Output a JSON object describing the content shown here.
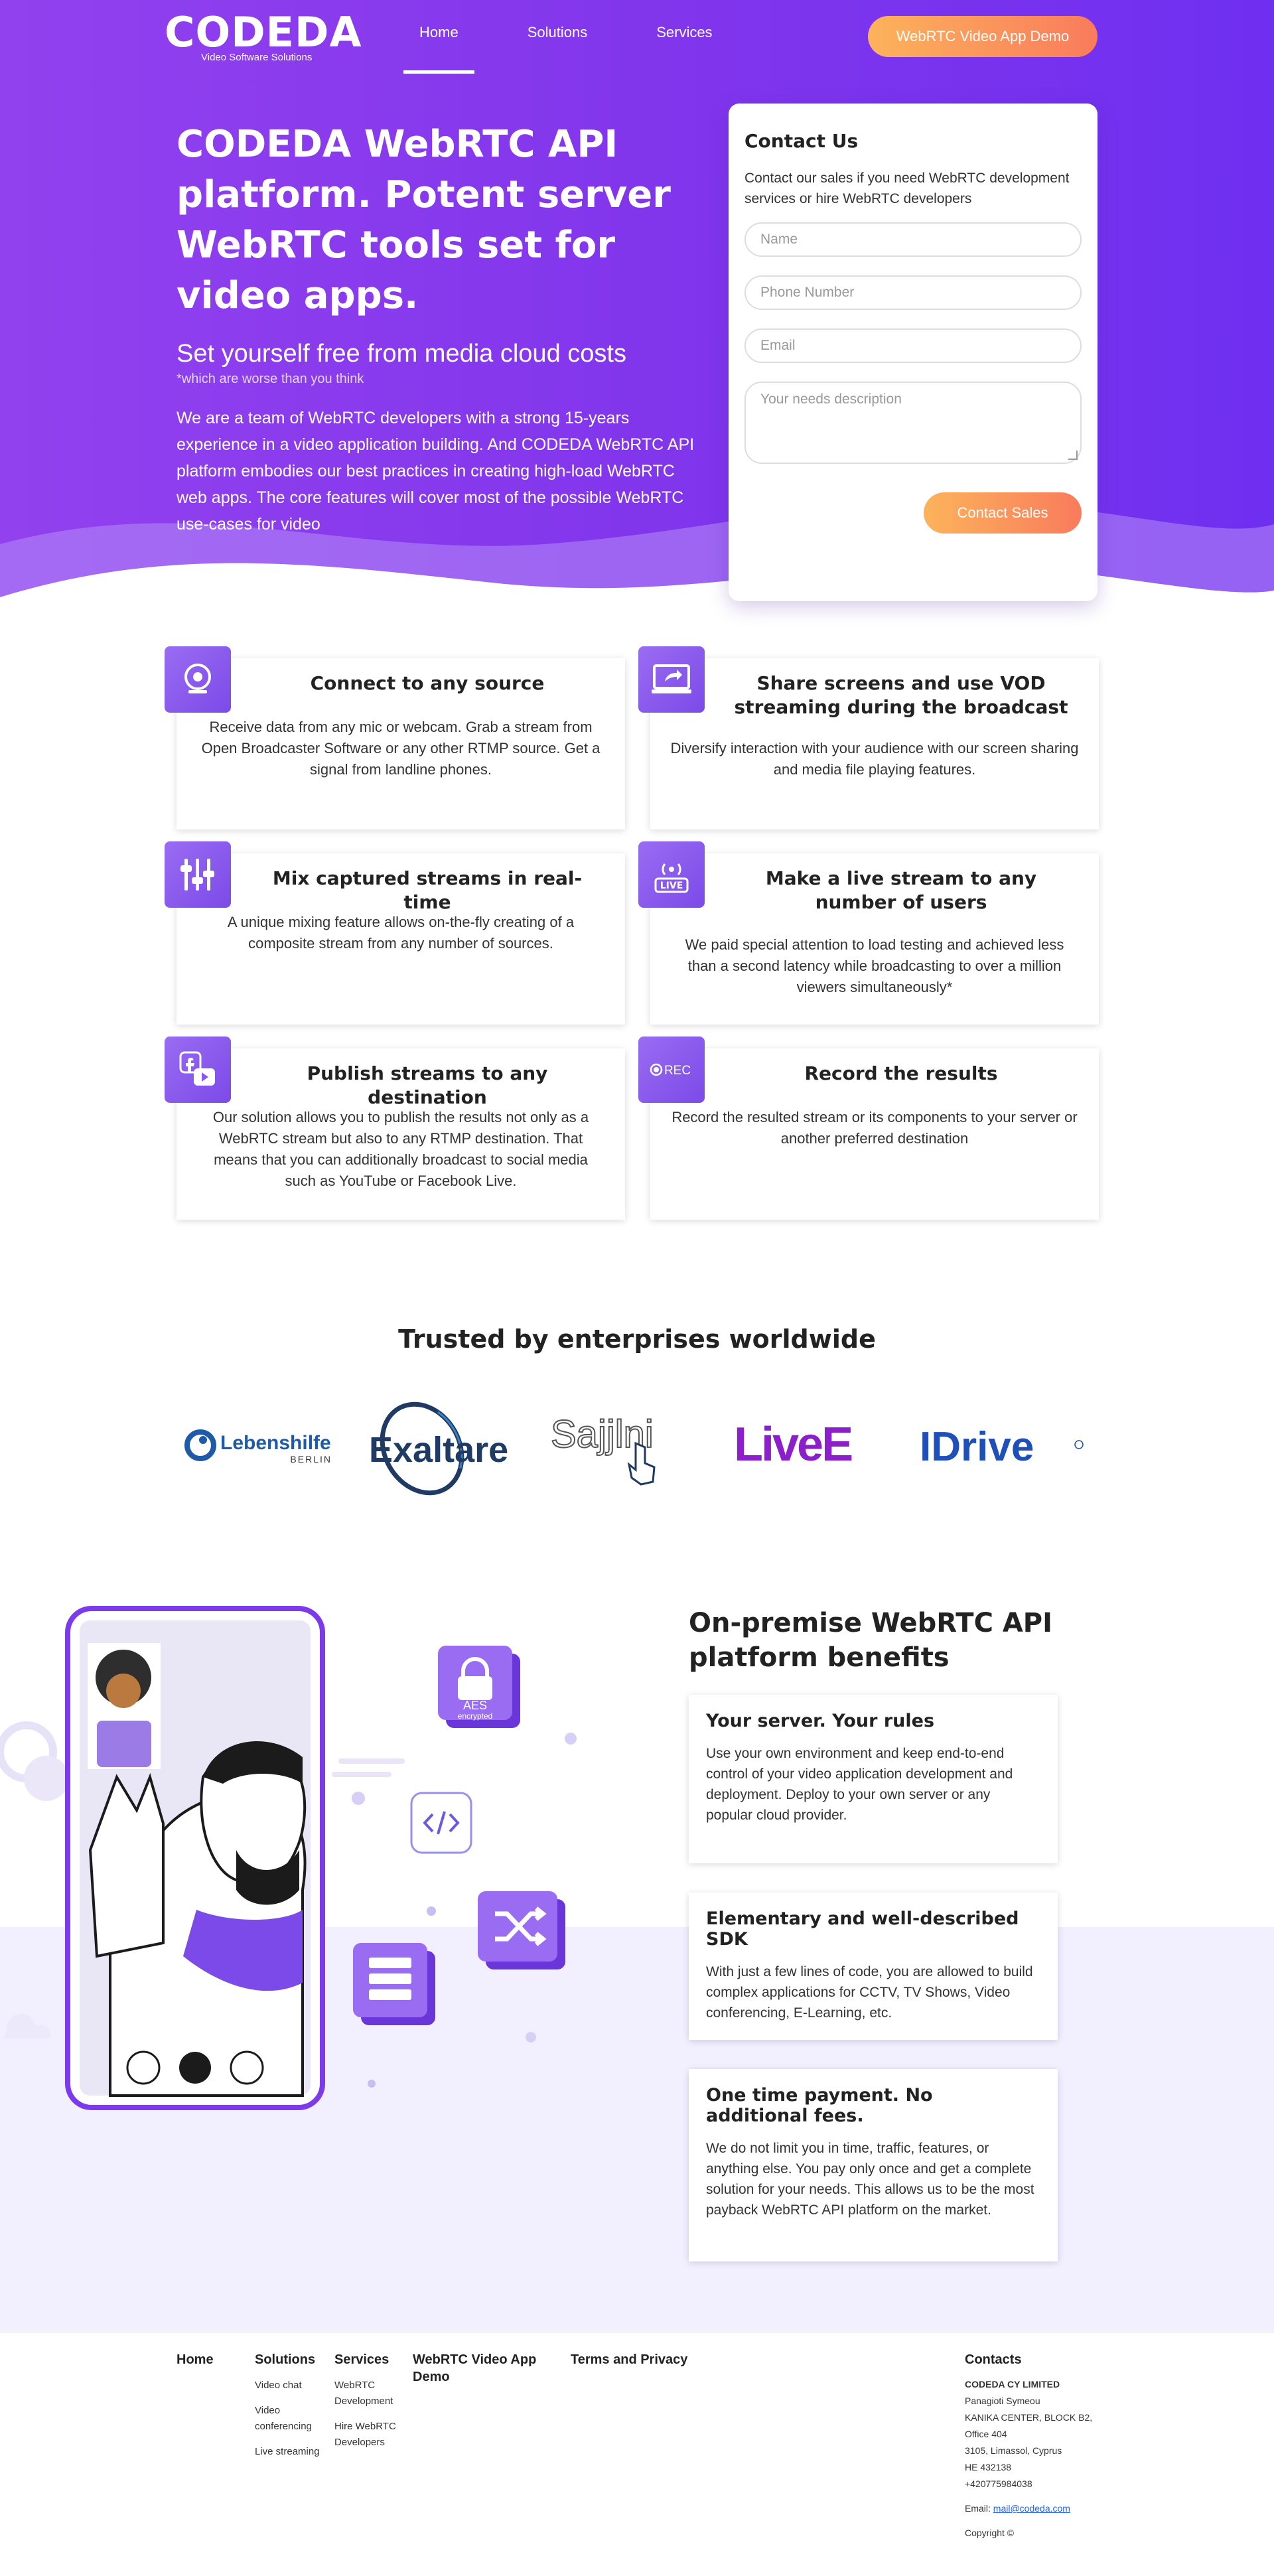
{
  "header": {
    "logo": "CODEDA",
    "logo_sub": "Video Software Solutions",
    "nav": [
      "Home",
      "Solutions",
      "Services"
    ],
    "demo_button": "WebRTC Video App Demo"
  },
  "hero": {
    "title": "CODEDA WebRTC API platform. Potent server WebRTC tools set for video apps.",
    "subtitle": "Set yourself free from media cloud costs",
    "note": "*which are worse than you think",
    "description": "We are a team of WebRTC developers with a strong 15-years experience in a video application building. And CODEDA WebRTC API platform embodies our best practices in creating high-load WebRTC web apps. The core features will cover most of the possible WebRTC use-cases for video"
  },
  "contact": {
    "title": "Contact Us",
    "text": "Contact our sales if you need WebRTC development services or hire WebRTC developers",
    "name_placeholder": "Name",
    "phone_placeholder": "Phone Number",
    "email_placeholder": "Email",
    "needs_placeholder": "Your needs description",
    "button": "Contact Sales"
  },
  "features": [
    {
      "title": "Connect to any source",
      "text": "Receive data from any mic or webcam. Grab a stream from Open Broadcaster Software or any other RTMP source. Get a signal from landline phones.",
      "icon": "webcam-icon"
    },
    {
      "title": "Share screens and use VOD streaming during the broadcast",
      "text": "Diversify interaction with your audience with our screen sharing and media file playing features.",
      "icon": "share-screen-icon"
    },
    {
      "title": "Mix captured streams in real-time",
      "text": "A unique mixing feature allows on-the-fly creating of a composite stream from any number of sources.",
      "icon": "mixer-icon"
    },
    {
      "title": "Make a live stream to any number of users",
      "text": "We paid special attention to load testing and achieved less than a second latency while broadcasting to over a million viewers simultaneously*",
      "icon": "live-icon",
      "icon_label": "LIVE"
    },
    {
      "title": "Publish streams to any destination",
      "text": "Our solution allows you to publish the results not only as a WebRTC stream but also to any RTMP destination. That means that you can additionally broadcast to social media such as YouTube or Facebook Live.",
      "icon": "social-icon"
    },
    {
      "title": "Record the results",
      "text": "Record the resulted stream or its components to your server or another preferred destination",
      "icon": "rec-icon",
      "icon_label": "REC"
    }
  ],
  "trusted": {
    "title": "Trusted by enterprises worldwide",
    "brands": [
      {
        "name": "Lebenshilfe",
        "sub": "BERLIN",
        "color": "#1e5aa8"
      },
      {
        "name": "Exaltare",
        "color": "#1f3a63"
      },
      {
        "name": "Sajjlni",
        "color": "#555555"
      },
      {
        "name": "LiveE",
        "color": "#8b1fc9"
      },
      {
        "name": "IDrive",
        "color": "#1f4fb8",
        "accent": "#e03a2f"
      }
    ]
  },
  "benefits": {
    "title": "On-premise WebRTC API platform benefits",
    "items": [
      {
        "title": "Your server. Your rules",
        "text": "Use your own environment and keep end-to-end control of your video application development and deployment. Deploy to your own server or any popular cloud provider."
      },
      {
        "title": "Elementary and well-described SDK",
        "text": "With just a few lines of code, you are allowed to build complex applications for CCTV, TV Shows, Video conferencing, E-Learning, etc."
      },
      {
        "title": "One time payment. No additional fees.",
        "text": "We do not limit you in time, traffic, features, or anything else. You pay only once and get a complete solution for your needs. This allows us to be the most payback WebRTC API platform on the market."
      }
    ],
    "illus_badge_top": "AES",
    "illus_badge_bottom": "encrypted"
  },
  "footer": {
    "home": "Home",
    "solutions": {
      "title": "Solutions",
      "links": [
        "Video chat",
        "Video conferencing",
        "Live streaming"
      ]
    },
    "services": {
      "title": "Services",
      "links": [
        "WebRTC Development",
        "Hire WebRTC Developers"
      ]
    },
    "demo": "WebRTC Video App Demo",
    "terms": "Terms and Privacy",
    "contacts": {
      "title": "Contacts",
      "company": "CODEDA CY LIMITED",
      "lines": [
        "Panagioti Symeou",
        "KANIKA CENTER, BLOCK B2, Office 404",
        "3105, Limassol, Cyprus",
        "HE 432138",
        "+420775984038"
      ],
      "email_label": "Email:",
      "email": "mail@codeda.com",
      "copyright": "Copyright ©"
    }
  },
  "colors": {
    "brand_purple": "#8236ec",
    "accent_orange": "#f97b5c",
    "accent_yellow": "#fcb35b"
  }
}
